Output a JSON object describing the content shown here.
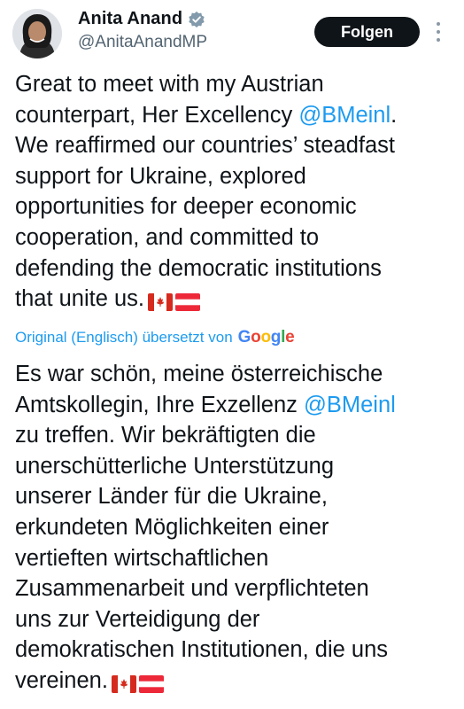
{
  "author": {
    "name": "Anita Anand",
    "handle": "@AnitaAnandMP",
    "follow_label": "Folgen"
  },
  "original": {
    "lines": [
      "Great to meet with my Austrian",
      "counterpart, Her Excellency ",
      "We reaffirmed our countries’ steadfast",
      "support for Ukraine, explored",
      "opportunities for deeper economic",
      "cooperation, and committed to",
      "defending the democratic institutions",
      "that unite us."
    ],
    "mention": "@BMeinl",
    "mention_suffix": "."
  },
  "translation_note": {
    "prefix": "Original (Englisch) übersetzt von",
    "provider": "Google"
  },
  "translated": {
    "lines": [
      "Es war schön, meine österreichische",
      "Amtskollegin, Ihre Exzellenz ",
      "zu treffen. Wir bekräftigten die",
      "unerschütterliche Unterstützung",
      "unserer Länder für die Ukraine,",
      "erkundeten Möglichkeiten einer",
      "vertieften wirtschaftlichen",
      "Zusammenarbeit und verpflichteten",
      "uns zur Verteidigung der",
      "demokratischen Institutionen, die uns",
      "vereinen."
    ],
    "mention": "@BMeinl"
  },
  "icons": {
    "verified": "verified-badge-icon",
    "more": "more-options-icon",
    "flag_1": "canada-flag-icon",
    "flag_2": "austria-flag-icon"
  },
  "colors": {
    "link": "#1d9bf0",
    "text": "#0f1419",
    "secondary": "#536471",
    "follow_bg": "#0f1419"
  }
}
